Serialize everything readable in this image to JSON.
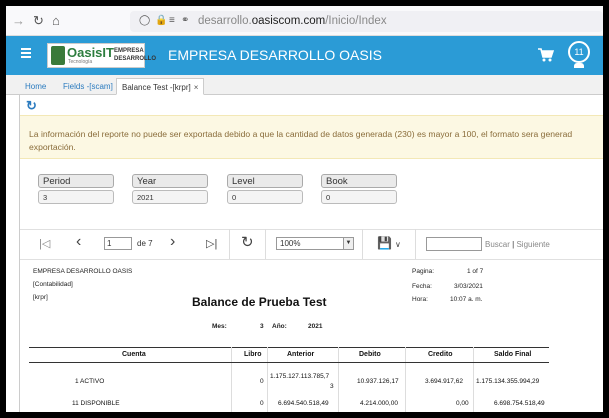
{
  "browser": {
    "back_icon": "arrow-left-icon",
    "reload_icon": "reload-icon",
    "home_icon": "home-icon",
    "url_prefix": "desarrollo.",
    "url_domain": "oasiscom.com",
    "url_path": "/Inicio/Index"
  },
  "header": {
    "logo_text": "OasisIT",
    "logo_sub": "Tecnología",
    "logo_company_line1": "EMPRESA",
    "logo_company_line2": "DESARROLLO",
    "title": "EMPRESA DESARROLLO OASIS",
    "notification_count": "11",
    "accent_color": "#2b9bd6"
  },
  "tabs": [
    {
      "label": "Home",
      "closable": false
    },
    {
      "label": "Fields -[scam]",
      "closable": true
    },
    {
      "label": "Balance Test -[krpr]",
      "closable": true,
      "active": true
    }
  ],
  "warning": {
    "text": "La información del reporte no puede ser exportada debido a que la cantidad de datos generada (230) es mayor a 100, el formato sera generad",
    "text2": "exportación."
  },
  "params": [
    {
      "label": "Period",
      "value": "3"
    },
    {
      "label": "Year",
      "value": "2021"
    },
    {
      "label": "Level",
      "value": "0"
    },
    {
      "label": "Book",
      "value": "0"
    }
  ],
  "toolbar": {
    "page_value": "1",
    "of_pages": "de 7",
    "zoom": "100%",
    "search_label": "Buscar",
    "next_label": "Siguiente",
    "separator": "|"
  },
  "report": {
    "company": "EMPRESA DESARROLLO OASIS",
    "module": "[Contabilidad]",
    "code": "[krpr]",
    "title": "Balance de Prueba Test",
    "page_label": "Pagina:",
    "page_value": "1 of 7",
    "date_label": "Fecha:",
    "date_value": "3/03/2021",
    "time_label": "Hora:",
    "time_value": "10:07 a. m.",
    "month_label": "Mes:",
    "month_value": "3",
    "year_label": "Año:",
    "year_value": "2021",
    "columns": [
      "Cuenta",
      "Libro",
      "Anterior",
      "Debito",
      "Credito",
      "Saldo Final"
    ],
    "rows": [
      {
        "account": "1 ACTIVO",
        "libro": "0",
        "anterior_1": "1.175.127.113.785,7",
        "anterior_2": "3",
        "debito": "10.937.126,17",
        "credito": "3.694.917,62",
        "saldo": "1.175.134.355.994,29"
      },
      {
        "account": "11 DISPONIBLE",
        "libro": "0",
        "anterior_1": "6.694.540.518,49",
        "anterior_2": "",
        "debito": "4.214.000,00",
        "credito": "0,00",
        "saldo": "6.698.754.518,49"
      }
    ]
  }
}
